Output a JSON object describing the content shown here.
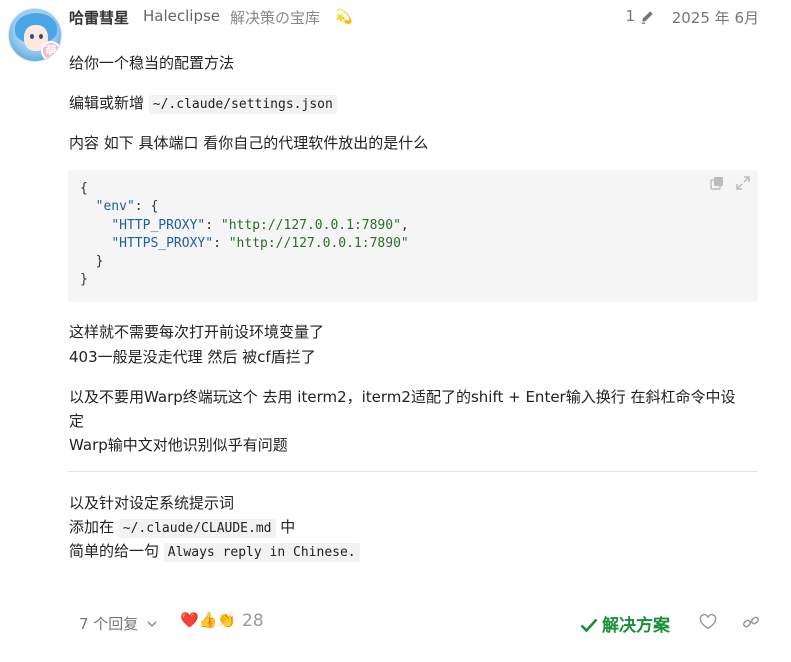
{
  "post": {
    "author": {
      "username": "哈雷彗星",
      "full_name": "Haleclipse",
      "title": "解决策の宝库",
      "flair_icon": "sparkle-star-icon",
      "avatar_badge": "萌"
    },
    "edit_count": "1",
    "date": "2025 年 6月",
    "body": {
      "p1": "给你一个稳当的配置方法",
      "p2_prefix": "编辑或新增 ",
      "p2_code": "~/.claude/settings.json",
      "p3": "内容 如下 具体端口 看你自己的代理软件放出的是什么",
      "code_block": {
        "open_brace": "{",
        "env_key": "\"env\"",
        "env_sep": ": {",
        "http_key": "\"HTTP_PROXY\"",
        "http_sep": ": ",
        "http_val": "\"http://127.0.0.1:7890\"",
        "http_end": ",",
        "https_key": "\"HTTPS_PROXY\"",
        "https_sep": ": ",
        "https_val": "\"http://127.0.0.1:7890\"",
        "inner_close": "}",
        "outer_close": "}"
      },
      "p4_line1": "这样就不需要每次打开前设环境变量了",
      "p4_line2": "403一般是没走代理 然后 被cf盾拦了",
      "p5_line1": "以及不要用Warp终端玩这个 去用 iterm2，iterm2适配了的shift + Enter输入换行 在斜杠命令中设",
      "p5_line2": "定",
      "p5_line3": "Warp输中文对他识别似乎有问题",
      "p6_line1": "以及针对设定系统提示词",
      "p6_prefix": "添加在 ",
      "p6_code": "~/.claude/CLAUDE.md",
      "p6_suffix": " 中",
      "p7_prefix": "简单的给一句 ",
      "p7_code": "Always reply in Chinese."
    },
    "footer": {
      "replies_label": "7 个回复",
      "reactions": "❤️👍👏",
      "reaction_count": "28",
      "solution_label": "解决方案"
    }
  },
  "colors": {
    "solution_green": "#1a8f3a",
    "code_bg": "#f5f5f5",
    "json_key": "#1f5f9c",
    "json_string": "#2e6b2e"
  }
}
